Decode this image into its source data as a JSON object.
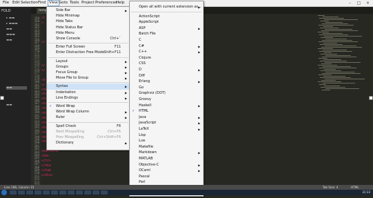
{
  "menubar": [
    "File",
    "Edit",
    "Selection",
    "Find",
    "View",
    "Goto",
    "Tools",
    "Project",
    "Preferences",
    "Help"
  ],
  "sidebar": {
    "folders_label": "FOLD"
  },
  "tab": {
    "label": "templat"
  },
  "gutter_lines": [
    "159",
    "160",
    "161",
    "162",
    "163",
    "164",
    "165",
    "166",
    "167",
    "168",
    "169",
    "170",
    "171",
    "172",
    "173",
    "174",
    "175",
    "176",
    "177",
    "178",
    "179",
    "180",
    "181",
    "182",
    "183",
    "184",
    "185",
    "186",
    "187",
    "188",
    "189",
    "190",
    "191",
    "192",
    "193",
    "194",
    "195",
    "196",
    "197",
    "198",
    "199",
    "200",
    "201",
    "202",
    "203",
    "204",
    "205",
    "206",
    "207",
    "208",
    "209",
    "210",
    "211",
    "212",
    "213",
    "214",
    "215"
  ],
  "code_lines": [
    "<l",
    "<",
    "",
    "",
    "",
    "</",
    "",
    "",
    "",
    "",
    "</",
    "</",
    "",
    "<d",
    "</",
    "<tb",
    "<tr",
    "<tr",
    "<tr>",
    "<td>BUSP",
    "<td>",
    "<td>",
    "<tr>",
    "<td>",
    "<td>ST/BO",
    "<td>",
    "<td>",
    "",
    "<td>SALAR",
    "<td>",
    "</tr>",
    "</tbo",
    "</tab",
    "</div>",
    ""
  ],
  "view_menu": {
    "items": [
      {
        "label": "Side Bar",
        "submenu": true
      },
      {
        "label": "Hide Minimap"
      },
      {
        "label": "Hide Tabs"
      },
      {
        "label": "Hide Status Bar"
      },
      {
        "label": "Hide Menu"
      },
      {
        "label": "Show Console",
        "shortcut": "Ctrl+`"
      },
      {
        "sep": true
      },
      {
        "label": "Enter Full Screen",
        "shortcut": "F11"
      },
      {
        "label": "Enter Distraction Free Mode",
        "shortcut": "Shift+F11"
      },
      {
        "sep": true
      },
      {
        "label": "Layout",
        "submenu": true
      },
      {
        "label": "Groups",
        "submenu": true
      },
      {
        "label": "Focus Group",
        "submenu": true
      },
      {
        "label": "Move File to Group",
        "submenu": true
      },
      {
        "sep": true
      },
      {
        "label": "Syntax",
        "submenu": true,
        "highlight": true
      },
      {
        "label": "Indentation",
        "submenu": true
      },
      {
        "label": "Line Endings",
        "submenu": true
      },
      {
        "sep": true
      },
      {
        "label": "Word Wrap",
        "checked": true
      },
      {
        "label": "Word Wrap Column",
        "submenu": true
      },
      {
        "label": "Ruler",
        "submenu": true
      },
      {
        "sep": true
      },
      {
        "label": "Spell Check",
        "shortcut": "F6"
      },
      {
        "label": "Next Misspelling",
        "shortcut": "Ctrl+F6",
        "disabled": true
      },
      {
        "label": "Prev Misspelling",
        "shortcut": "Ctrl+Shift+F6",
        "disabled": true
      },
      {
        "label": "Dictionary",
        "submenu": true
      }
    ]
  },
  "syntax_menu": {
    "items": [
      {
        "label": "Open all with current extension as...",
        "submenu": true
      },
      {
        "sep": true
      },
      {
        "label": "ActionScript"
      },
      {
        "label": "AppleScript"
      },
      {
        "label": "ASP",
        "submenu": true
      },
      {
        "label": "Batch File"
      },
      {
        "label": "C"
      },
      {
        "label": "C#",
        "submenu": true
      },
      {
        "label": "C++",
        "submenu": true
      },
      {
        "label": "Clojure"
      },
      {
        "label": "CSS"
      },
      {
        "label": "D",
        "submenu": true
      },
      {
        "label": "Diff"
      },
      {
        "label": "Erlang",
        "submenu": true
      },
      {
        "label": "Go"
      },
      {
        "label": "Graphviz (DOT)"
      },
      {
        "label": "Groovy"
      },
      {
        "label": "Haskell",
        "submenu": true
      },
      {
        "label": "HTML",
        "checked": true
      },
      {
        "label": "Java",
        "submenu": true
      },
      {
        "label": "JavaScript",
        "submenu": true
      },
      {
        "label": "LaTeX",
        "submenu": true
      },
      {
        "label": "Lisp"
      },
      {
        "label": "Lua"
      },
      {
        "label": "Makefile"
      },
      {
        "label": "Markdown",
        "submenu": true
      },
      {
        "label": "MATLAB"
      },
      {
        "label": "Objective-C",
        "submenu": true
      },
      {
        "label": "OCaml",
        "submenu": true
      },
      {
        "label": "Pascal"
      },
      {
        "label": "Perl"
      },
      {
        "label": "PHP"
      },
      {
        "label": "Plain Text"
      }
    ]
  },
  "statusbar": {
    "left": "Line 166, Column 15",
    "tab_size": "Tab Size: 4",
    "syntax": "HTML"
  },
  "taskbar": {
    "clock": "22:33"
  },
  "colors": {
    "editor_bg": "#272822",
    "menu_bg": "#f5f5f5",
    "highlight": "#cfe2f7",
    "tag_color": "#f92672"
  }
}
